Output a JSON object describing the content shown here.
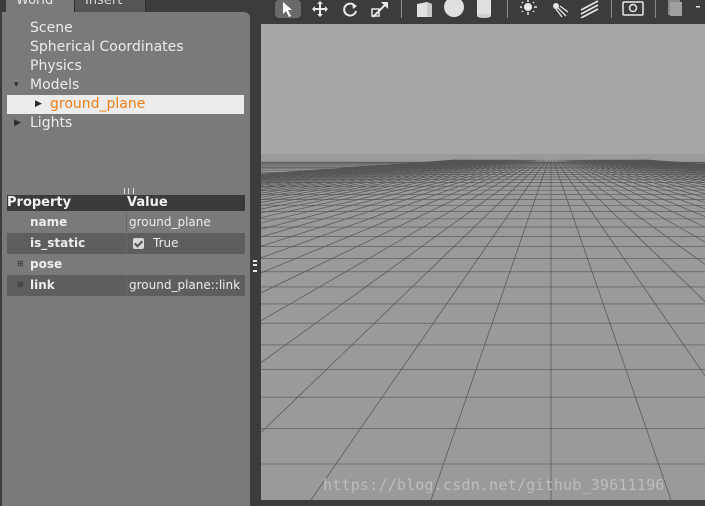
{
  "tabs": {
    "world": "World",
    "insert": "Insert"
  },
  "tree": [
    {
      "label": "Scene",
      "arrow": ""
    },
    {
      "label": "Spherical Coordinates",
      "arrow": ""
    },
    {
      "label": "Physics",
      "arrow": ""
    },
    {
      "label": "Models",
      "arrow": "▾"
    },
    {
      "label": "ground_plane",
      "arrow": "▶"
    },
    {
      "label": "Lights",
      "arrow": "▶"
    }
  ],
  "properties": {
    "header_property": "Property",
    "header_value": "Value",
    "rows": [
      {
        "key": "name",
        "value": "ground_plane"
      },
      {
        "key": "is_static",
        "value": "True"
      },
      {
        "key": "pose",
        "value": ""
      },
      {
        "key": "link",
        "value": "ground_plane::link"
      }
    ]
  },
  "colors": {
    "selected_text": "#ef7e16",
    "panel": "#7a7a7a",
    "dark": "#3c3c3c",
    "sky": "#a6a6a6",
    "ground": "#9a9a9a"
  },
  "icons": [
    "select-arrow-icon",
    "translate-icon",
    "rotate-icon",
    "scale-icon",
    "box-icon",
    "sphere-icon",
    "cylinder-icon",
    "point-light-icon",
    "spot-light-icon",
    "directional-light-icon",
    "screenshot-icon",
    "log-icon"
  ],
  "watermark": "https://blog.csdn.net/github_39611196"
}
